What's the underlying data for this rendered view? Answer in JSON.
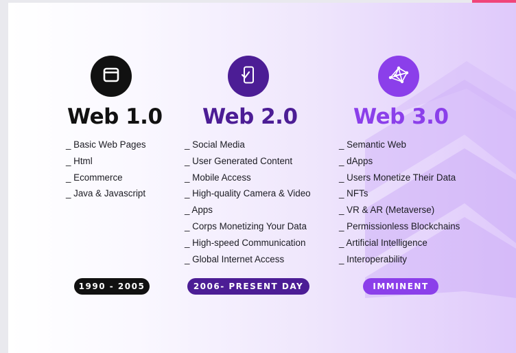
{
  "colors": {
    "web1": "#111111",
    "web2": "#4c1d95",
    "web3": "#8b3fea",
    "accent": "#f0457a"
  },
  "columns": [
    {
      "icon": "browser-window-icon",
      "title": "Web 1.0",
      "items": [
        "_ Basic Web Pages",
        "_ Html",
        "_ Ecommerce",
        "_ Java & Javascript"
      ],
      "period": "1990 - 2005"
    },
    {
      "icon": "mobile-phone-check-icon",
      "title": "Web 2.0",
      "items": [
        "_ Social Media",
        "_ User Generated Content",
        "_ Mobile Access",
        "_ High-quality Camera & Video",
        "_ Apps",
        "_ Corps Monetizing Your Data",
        "_ High-speed Communication",
        "_ Global Internet Access"
      ],
      "period": "2006- PRESENT DAY"
    },
    {
      "icon": "network-mesh-icon",
      "title": "Web 3.0",
      "items": [
        "_ Semantic Web",
        "_ dApps",
        "_ Users Monetize Their Data",
        "_ NFTs",
        "_ VR & AR (Metaverse)",
        "_ Permissionless Blockchains",
        "_ Artificial Intelligence",
        "_ Interoperability"
      ],
      "period": "IMMINENT"
    }
  ]
}
